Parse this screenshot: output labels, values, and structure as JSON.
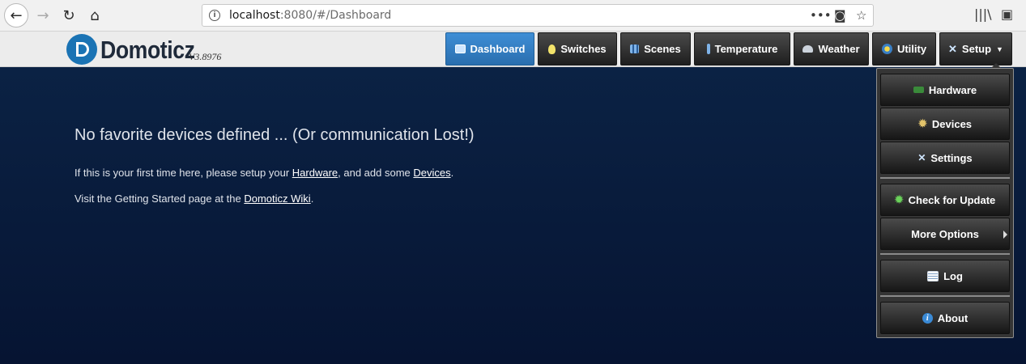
{
  "browser": {
    "url_host": "localhost",
    "url_rest": ":8080/#/Dashboard"
  },
  "app": {
    "name": "Domoticz",
    "version": "V3.8976"
  },
  "nav": {
    "tabs": [
      {
        "label": "Dashboard",
        "icon": "dashboard-icon"
      },
      {
        "label": "Switches",
        "icon": "lightbulb-icon"
      },
      {
        "label": "Scenes",
        "icon": "clapperboard-icon"
      },
      {
        "label": "Temperature",
        "icon": "thermometer-icon"
      },
      {
        "label": "Weather",
        "icon": "weather-cloud-icon"
      },
      {
        "label": "Utility",
        "icon": "utility-icon"
      },
      {
        "label": "Setup",
        "icon": "tools-icon"
      }
    ],
    "active": "Dashboard"
  },
  "main": {
    "title": "No favorite devices defined ... (Or communication Lost!)",
    "line1_pre": "If this is your first time here, please setup your ",
    "line1_link1": "Hardware",
    "line1_mid": ", and add some ",
    "line1_link2": "Devices",
    "line1_post": ".",
    "line2_pre": "Visit the Getting Started page at the ",
    "line2_link": "Domoticz Wiki",
    "line2_post": "."
  },
  "setup_menu": {
    "items": [
      {
        "label": "Hardware",
        "icon": "hardware-icon"
      },
      {
        "label": "Devices",
        "icon": "gear-icon"
      },
      {
        "label": "Settings",
        "icon": "tools-icon"
      },
      {
        "label": "Check for Update",
        "icon": "update-icon"
      },
      {
        "label": "More Options",
        "icon": "submenu-arrow-icon"
      },
      {
        "label": "Log",
        "icon": "log-icon"
      },
      {
        "label": "About",
        "icon": "info-icon"
      }
    ]
  },
  "colors": {
    "active_tab": "#3e8ed6",
    "background": "#081a35"
  }
}
